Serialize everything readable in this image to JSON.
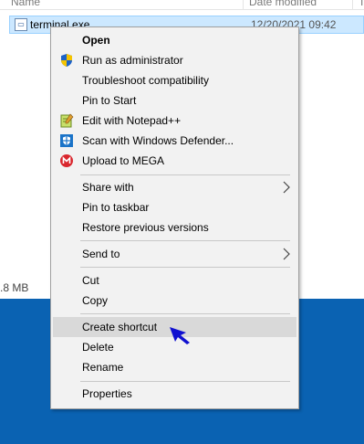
{
  "explorer": {
    "headers": {
      "name": "Name",
      "date_modified": "Date modified",
      "col3": "T"
    },
    "selected_file": {
      "name": "terminal.exe",
      "date_modified": "12/20/2021 09:42",
      "icon": "exe-file-icon"
    },
    "size_text": ".8 MB"
  },
  "context_menu": {
    "group1": [
      {
        "label": "Open",
        "bold": true,
        "icon": null
      },
      {
        "label": "Run as administrator",
        "icon": "uac-shield-icon"
      },
      {
        "label": "Troubleshoot compatibility",
        "icon": null
      },
      {
        "label": "Pin to Start",
        "icon": null
      },
      {
        "label": "Edit with Notepad++",
        "icon": "notepad-plus-plus-icon"
      },
      {
        "label": "Scan with Windows Defender...",
        "icon": "windows-defender-icon"
      },
      {
        "label": "Upload to MEGA",
        "icon": "mega-icon"
      }
    ],
    "group2": [
      {
        "label": "Share with",
        "submenu": true
      },
      {
        "label": "Pin to taskbar"
      },
      {
        "label": "Restore previous versions"
      }
    ],
    "group3": [
      {
        "label": "Send to",
        "submenu": true
      }
    ],
    "group4": [
      {
        "label": "Cut"
      },
      {
        "label": "Copy"
      }
    ],
    "group5": [
      {
        "label": "Create shortcut",
        "highlighted": true
      },
      {
        "label": "Delete"
      },
      {
        "label": "Rename"
      }
    ],
    "group6": [
      {
        "label": "Properties"
      }
    ]
  },
  "colors": {
    "menu_bg": "#f2f2f2",
    "highlight": "#d9d9d9",
    "selection": "#cce8ff",
    "desktop": "#0a62b2",
    "cursor": "#1010d0"
  }
}
